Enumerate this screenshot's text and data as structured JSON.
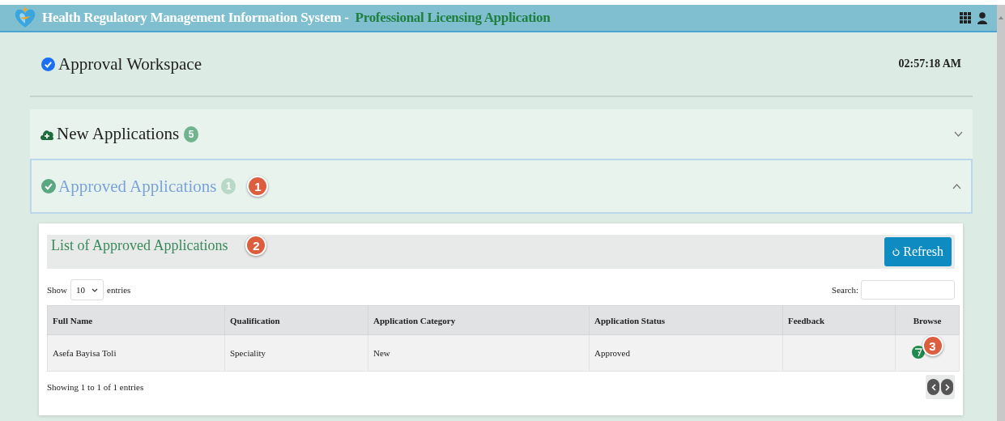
{
  "header": {
    "title": "Health Regulatory Management Information System -",
    "subtitle": "Professional Licensing Application"
  },
  "workspace": {
    "title": "Approval Workspace",
    "time": "02:57:18 AM"
  },
  "sections": [
    {
      "kind": "new",
      "title": "New Applications",
      "count": "5",
      "expanded": false
    },
    {
      "kind": "approved",
      "title": "Approved Applications",
      "count": "1",
      "expanded": true,
      "marker": "1"
    }
  ],
  "list": {
    "title": "List of Approved Applications",
    "marker": "2",
    "refresh_button": "Refresh",
    "show_label": "Show",
    "page_size": "10",
    "entries_label": "entries",
    "search_label": "Search:",
    "columns": [
      "Full Name",
      "Qualification",
      "Application Category",
      "Application Status",
      "Feedback",
      "Browse"
    ],
    "rows": [
      {
        "cells": [
          "Asefa Bayisa Toli",
          "Speciality",
          "New",
          "Approved",
          ""
        ],
        "browse_marker": "3"
      }
    ],
    "info": "Showing 1 to 1 of 1 entries"
  }
}
